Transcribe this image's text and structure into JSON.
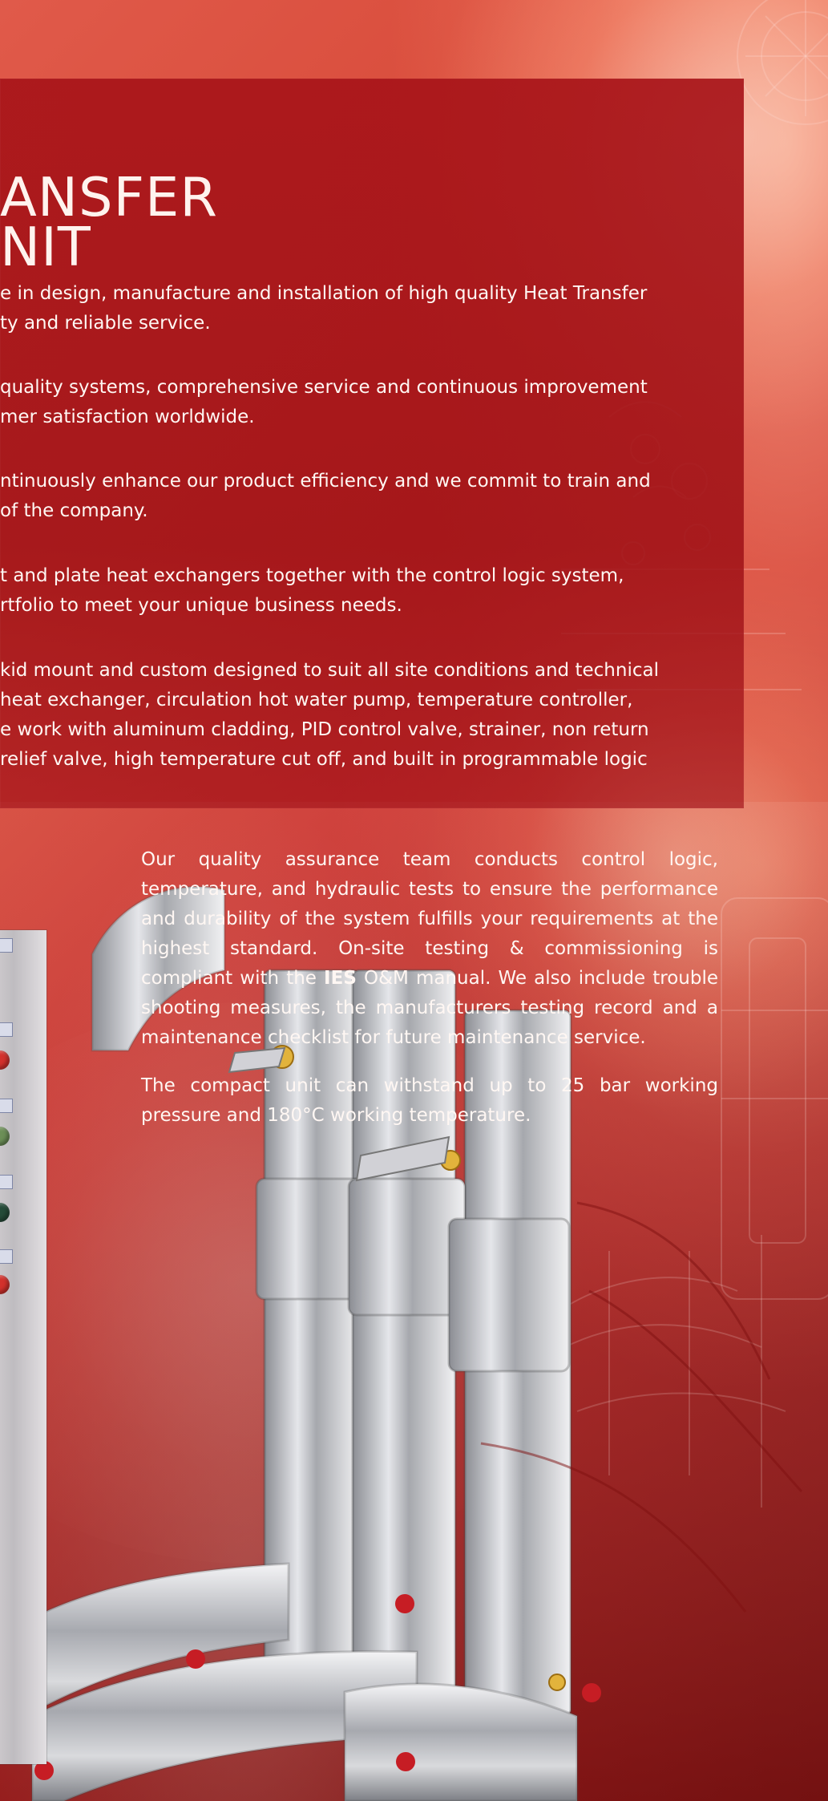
{
  "page": {
    "title_lines": [
      "ANSFER",
      "NIT"
    ],
    "body_lines": [
      "e in design, manufacture and installation of high quality Heat Transfer",
      "ty and reliable service.",
      "quality systems, comprehensive service and continuous improvement",
      "mer satisfaction worldwide.",
      "ntinuously enhance our product efficiency and we commit to train and",
      "of the company.",
      "t and plate heat exchangers together with the control logic system,",
      "rtfolio to meet your unique business needs.",
      "kid mount and custom designed to suit all site conditions and technical",
      "heat exchanger, circulation hot water pump, temperature controller,",
      "e work with aluminum cladding, PID control valve, strainer, non return",
      "relief valve, high temperature cut off, and built in programmable logic"
    ],
    "quality_paragraphs": [
      {
        "before": "Our quality assurance team conducts control logic, temperature, and hydraulic tests to ensure the performance and durability of the system fulfills your requirements at the highest standard. On-site testing & commissioning is compliant with the ",
        "strong": "IES",
        "after": " O&M manual. We also include trouble shooting measures, the manufacturers testing record and a maintenance checklist for future maintenance service."
      },
      {
        "text": "The compact unit can withstand up to 25 bar working pressure and 180°C working temperature."
      }
    ]
  },
  "colors": {
    "panel": "#a81419",
    "text": "#fff7f3",
    "background_accent": "#e05a4a"
  },
  "icons": {
    "background_art": "technical-drawing-lines",
    "equipment": "pipe-manifold",
    "valve": "red-handwheel-valve"
  }
}
